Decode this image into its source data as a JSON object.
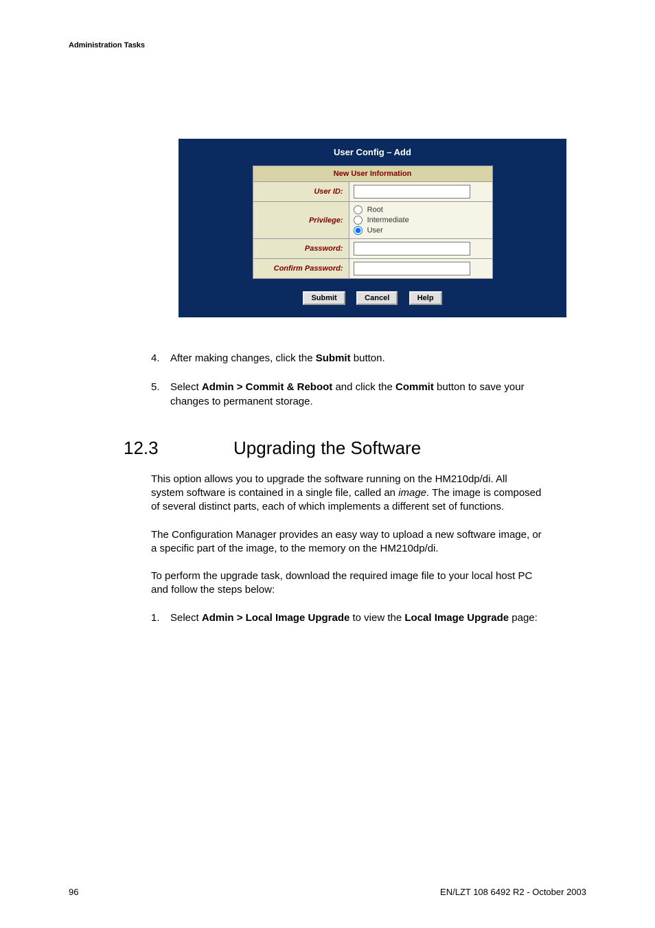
{
  "header": {
    "label": "Administration Tasks"
  },
  "screenshot": {
    "title": "User Config – Add",
    "form_header": "New User Information",
    "user_id_label": "User ID:",
    "user_id_value": "",
    "privilege_label": "Privilege:",
    "privilege_options": {
      "root": "Root",
      "intermediate": "Intermediate",
      "user": "User"
    },
    "password_label": "Password:",
    "password_value": "",
    "confirm_password_label": "Confirm Password:",
    "confirm_password_value": "",
    "buttons": {
      "submit": "Submit",
      "cancel": "Cancel",
      "help": "Help"
    }
  },
  "steps_upper": {
    "item4_num": "4.",
    "item4_prefix": "After making changes, click the ",
    "item4_bold": "Submit",
    "item4_suffix": " button.",
    "item5_num": "5.",
    "item5_prefix": "Select ",
    "item5_bold1": "Admin > Commit & Reboot",
    "item5_mid": " and click the ",
    "item5_bold2": "Commit",
    "item5_suffix": " button to save your changes to permanent storage."
  },
  "section": {
    "number": "12.3",
    "title": "Upgrading the Software",
    "p1a": "This option allows you to upgrade the software running on the HM210dp/di. All system software is contained in a single file, called an ",
    "p1_italic": "image",
    "p1b": ". The image is composed of several distinct parts, each of which implements a different set of functions.",
    "p2": "The Configuration Manager provides an easy way to upload a new software image, or a specific part of the image, to the memory on the HM210dp/di.",
    "p3": "To perform the upgrade task, download the required image file to your local host PC and follow the steps below:",
    "step1_num": "1.",
    "step1_prefix": "Select ",
    "step1_bold1": "Admin > Local Image Upgrade",
    "step1_mid": " to view the ",
    "step1_bold2": "Local Image Upgrade",
    "step1_suffix": " page:"
  },
  "footer": {
    "page": "96",
    "docid": "EN/LZT 108 6492 R2  - October 2003"
  }
}
